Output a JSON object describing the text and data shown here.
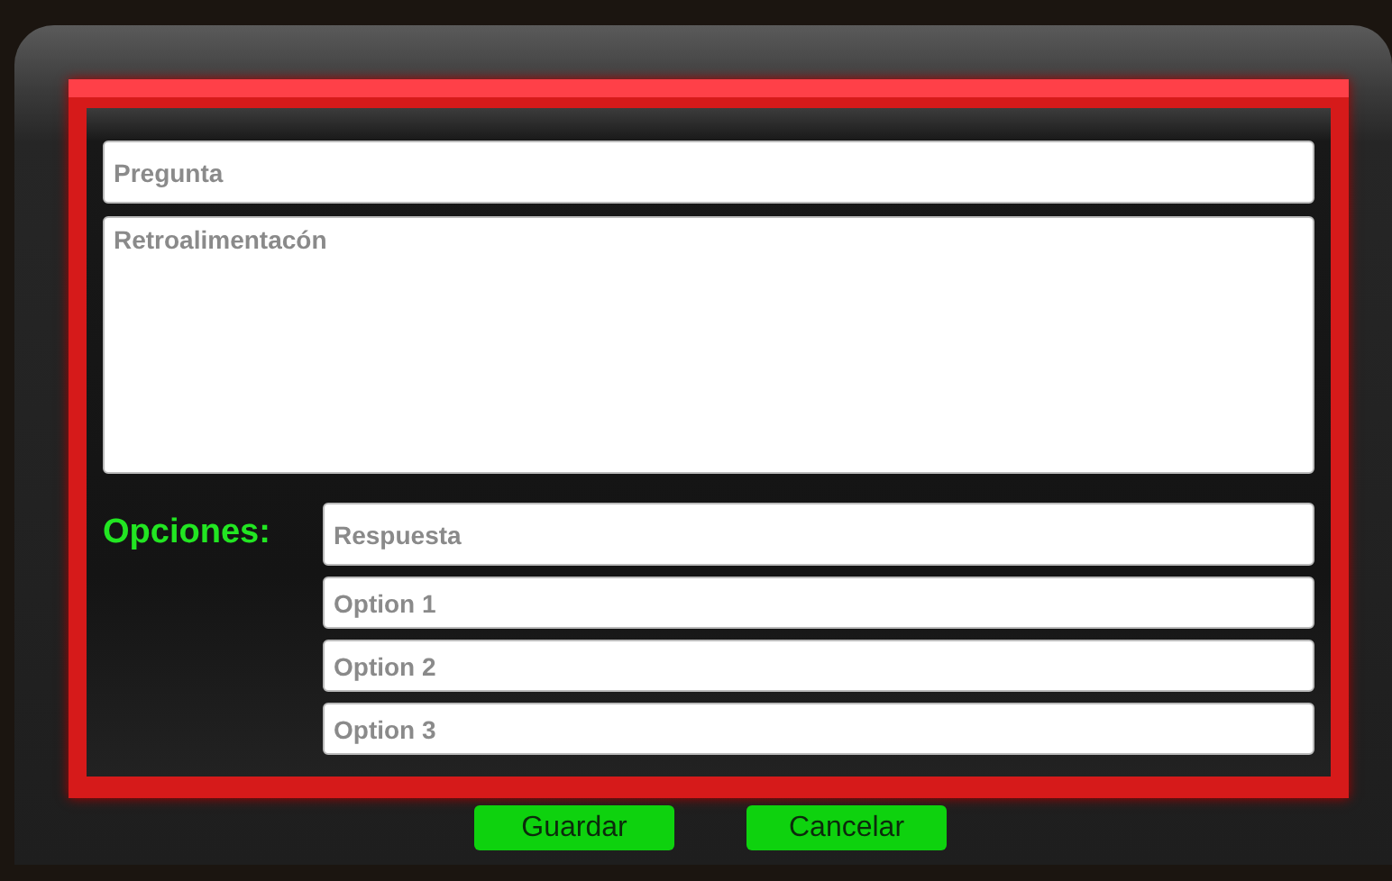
{
  "question": {
    "placeholder": "Pregunta"
  },
  "feedback": {
    "placeholder": "Retroalimentacón"
  },
  "options": {
    "label": "Opciones:",
    "fields": [
      {
        "placeholder": "Respuesta"
      },
      {
        "placeholder": "Option 1"
      },
      {
        "placeholder": "Option 2"
      },
      {
        "placeholder": "Option 3"
      }
    ]
  },
  "buttons": [
    {
      "label": "Guardar"
    },
    {
      "label": "Cancelar"
    }
  ]
}
